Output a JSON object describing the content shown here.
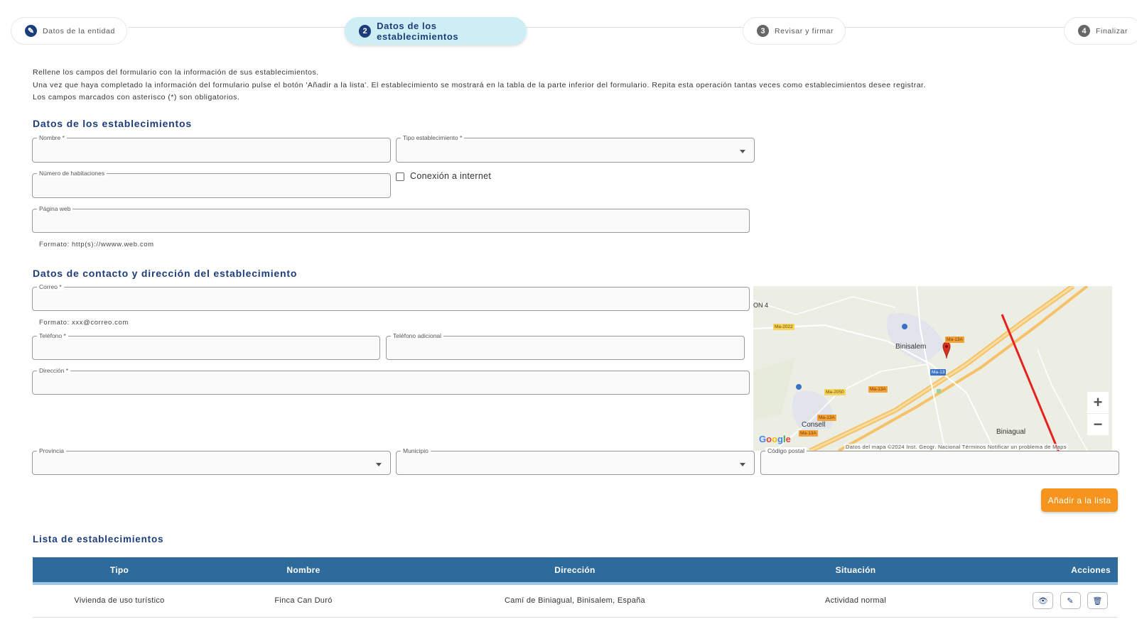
{
  "stepper": {
    "steps": [
      {
        "number": "✎",
        "label": "Datos de la entidad",
        "state": "done"
      },
      {
        "number": "2",
        "label": "Datos de los establecimientos",
        "state": "active"
      },
      {
        "number": "3",
        "label": "Revisar y firmar",
        "state": "pending"
      },
      {
        "number": "4",
        "label": "Finalizar",
        "state": "pending"
      }
    ]
  },
  "intro": {
    "line1": "Rellene los campos del formulario con la información de sus establecimientos.",
    "line2": "Una vez que haya completado la información del formulario pulse el botón 'Añadir a la lista'. El establecimiento se mostrará en la tabla de la parte inferior del formulario. Repita esta operación tantas veces como establecimientos desee registrar.",
    "line3": "Los campos marcados con asterisco (*) son obligatorios."
  },
  "section1": {
    "title": "Datos de los establecimientos",
    "nombre_label": "Nombre *",
    "tipo_label": "Tipo establecimiento *",
    "habitaciones_label": "Número de habitaciones",
    "internet_label": "Conexión a internet",
    "web_label": "Página web",
    "web_helper": "Formato: http(s)://wwww.web.com"
  },
  "section2": {
    "title": "Datos de contacto y dirección del establecimiento",
    "correo_label": "Correo *",
    "correo_helper": "Formato: xxx@correo.com",
    "telefono_label": "Teléfono *",
    "telefono_adicional_label": "Teléfono adicional",
    "direccion_label": "Dirección *",
    "provincia_label": "Provincia",
    "municipio_label": "Municipio",
    "cp_label": "Código postal"
  },
  "map": {
    "places": {
      "binisalem": "Binisalem",
      "consell": "Consell",
      "biniagual": "Biniagual",
      "on4": "ON 4"
    },
    "roads": {
      "ma2022": "Ma-2022",
      "ma13a_1": "Ma-13A",
      "ma13": "Ma-13",
      "ma2050": "Ma-2050",
      "ma13a_2": "Ma-13A",
      "ma13a_3": "Ma-13A",
      "ma13a_4": "Ma-13A"
    },
    "zoom_in": "+",
    "zoom_out": "−",
    "attribution": "Datos del mapa ©2024 Inst. Geogr. Nacional   Términos   Notificar un problema de Maps",
    "logo": "Google"
  },
  "add_button": "Añadir a la lista",
  "list": {
    "title": "Lista de establecimientos",
    "columns": [
      "Tipo",
      "Nombre",
      "Dirección",
      "Situación",
      "Acciones"
    ],
    "rows": [
      {
        "tipo": "Vivienda de uso turístico",
        "nombre": "Finca Can Duró",
        "direccion": "Camí de Biniagual, Binisalem, España",
        "situacion": "Actividad normal"
      }
    ]
  },
  "colors": {
    "primary": "#1d3d7a",
    "accent": "#f7941d",
    "table_header": "#2e6b9b",
    "active_step": "#cdeef5"
  }
}
